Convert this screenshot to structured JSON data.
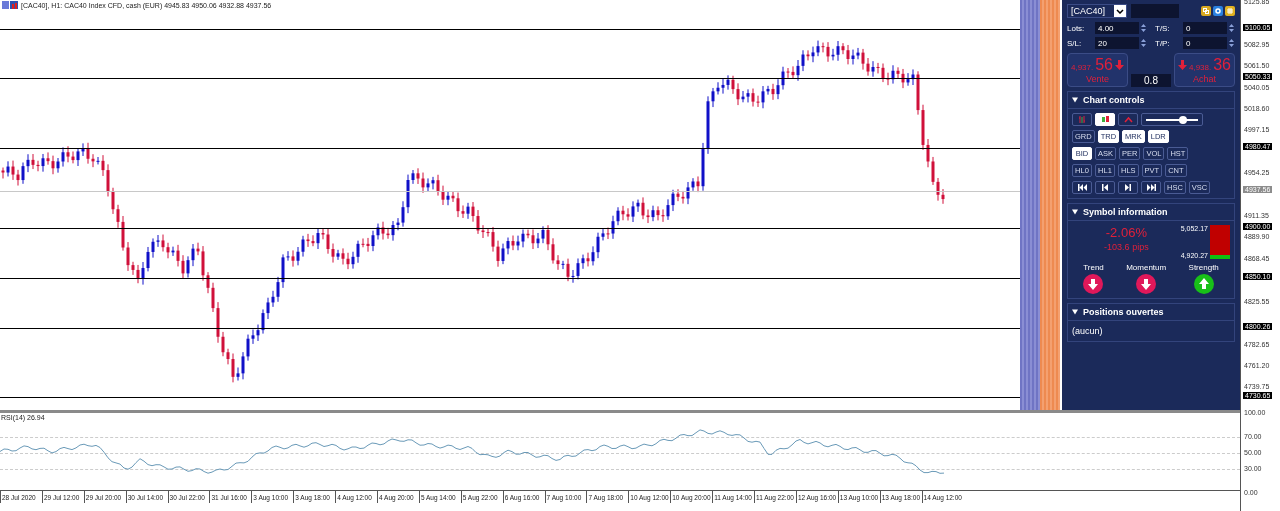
{
  "title_bar": {
    "text": "[CAC40], H1:  CAC40 Index CFD, cash (EUR)  4945.83 4950.06 4932.88 4937.56"
  },
  "price_axis": {
    "ticks": [
      "5125.85",
      "5082.95",
      "5061.50",
      "5040.05",
      "5018.60",
      "4997.15",
      "4954.25",
      "4911.35",
      "4889.90",
      "4868.45",
      "4825.55",
      "4782.65",
      "4761.20",
      "4739.75"
    ],
    "levels": [
      "5100.05",
      "5050.33",
      "4980.47",
      "4900.00",
      "4850.10",
      "4800.26",
      "4730.65"
    ],
    "current": "4937.56"
  },
  "trade_panel": {
    "symbol": "[CAC40]",
    "fields": [
      {
        "label": "Lots:",
        "value": "4.00"
      },
      {
        "label": "T/S:",
        "value": "0"
      },
      {
        "label": "S/L:",
        "value": "20"
      },
      {
        "label": "T/P:",
        "value": "0"
      }
    ],
    "sell": {
      "price_small": "4,937.",
      "price_big": "56",
      "label": "Vente"
    },
    "buy": {
      "price_small": "4,938.",
      "price_big": "36",
      "label": "Achat"
    },
    "spread": "0.8"
  },
  "chart_controls": {
    "title": "Chart controls",
    "expanded": true,
    "icon_buttons": [
      {
        "kind": "bars",
        "selected": false
      },
      {
        "kind": "candles",
        "selected": true
      },
      {
        "kind": "line",
        "selected": false
      }
    ],
    "slider": {
      "level": 0.72
    },
    "rows": [
      [
        {
          "label": "GRD",
          "selected": false
        },
        {
          "label": "TRD",
          "selected": true
        },
        {
          "label": "MRK",
          "selected": true
        },
        {
          "label": "LDR",
          "selected": true
        }
      ],
      [
        {
          "label": "BID",
          "selected": true
        },
        {
          "label": "ASK",
          "selected": false
        },
        {
          "label": "PER",
          "selected": false
        },
        {
          "label": "VOL",
          "selected": false
        },
        {
          "label": "HST",
          "selected": false
        }
      ],
      [
        {
          "label": "HL0",
          "selected": false
        },
        {
          "label": "HL1",
          "selected": false
        },
        {
          "label": "HLS",
          "selected": false
        },
        {
          "label": "PVT",
          "selected": false
        },
        {
          "label": "CNT",
          "selected": false
        }
      ]
    ],
    "nav_buttons": [
      {
        "kind": "first"
      },
      {
        "kind": "prev"
      },
      {
        "kind": "next"
      },
      {
        "kind": "last"
      },
      {
        "kind": "text",
        "label": "HSC"
      },
      {
        "kind": "text",
        "label": "VSC"
      }
    ]
  },
  "symbol_info": {
    "title": "Symbol information",
    "expanded": true,
    "change": "-2.06%",
    "pips": "-103.6 pips",
    "high": "5,052.17",
    "low": "4,920.27",
    "range_bar": {
      "level": 0.12
    },
    "indicators": [
      {
        "label": "Trend",
        "kind": "down"
      },
      {
        "label": "Momentum",
        "kind": "down"
      },
      {
        "label": "Strength",
        "kind": "up"
      }
    ]
  },
  "positions": {
    "title": "Positions ouvertes",
    "expanded": true,
    "empty_text": "(aucun)"
  },
  "rsi": {
    "label": "RSI(14) 26.94",
    "yticks": [
      "100.00",
      "70.00",
      "50.00",
      "30.00",
      "0.00"
    ]
  },
  "time_axis": [
    "28 Jul 2020",
    "29 Jul 12:00",
    "29 Jul 20:00",
    "30 Jul 14:00",
    "30 Jul 22:00",
    "31 Jul 16:00",
    "3 Aug 10:00",
    "3 Aug 18:00",
    "4 Aug 12:00",
    "4 Aug 20:00",
    "5 Aug 14:00",
    "5 Aug 22:00",
    "6 Aug 16:00",
    "7 Aug 10:00",
    "7 Aug 18:00",
    "10 Aug 12:00",
    "10 Aug 20:00",
    "11 Aug 14:00",
    "11 Aug 22:00",
    "12 Aug 16:00",
    "13 Aug 10:00",
    "13 Aug 18:00",
    "14 Aug 12:00"
  ]
}
